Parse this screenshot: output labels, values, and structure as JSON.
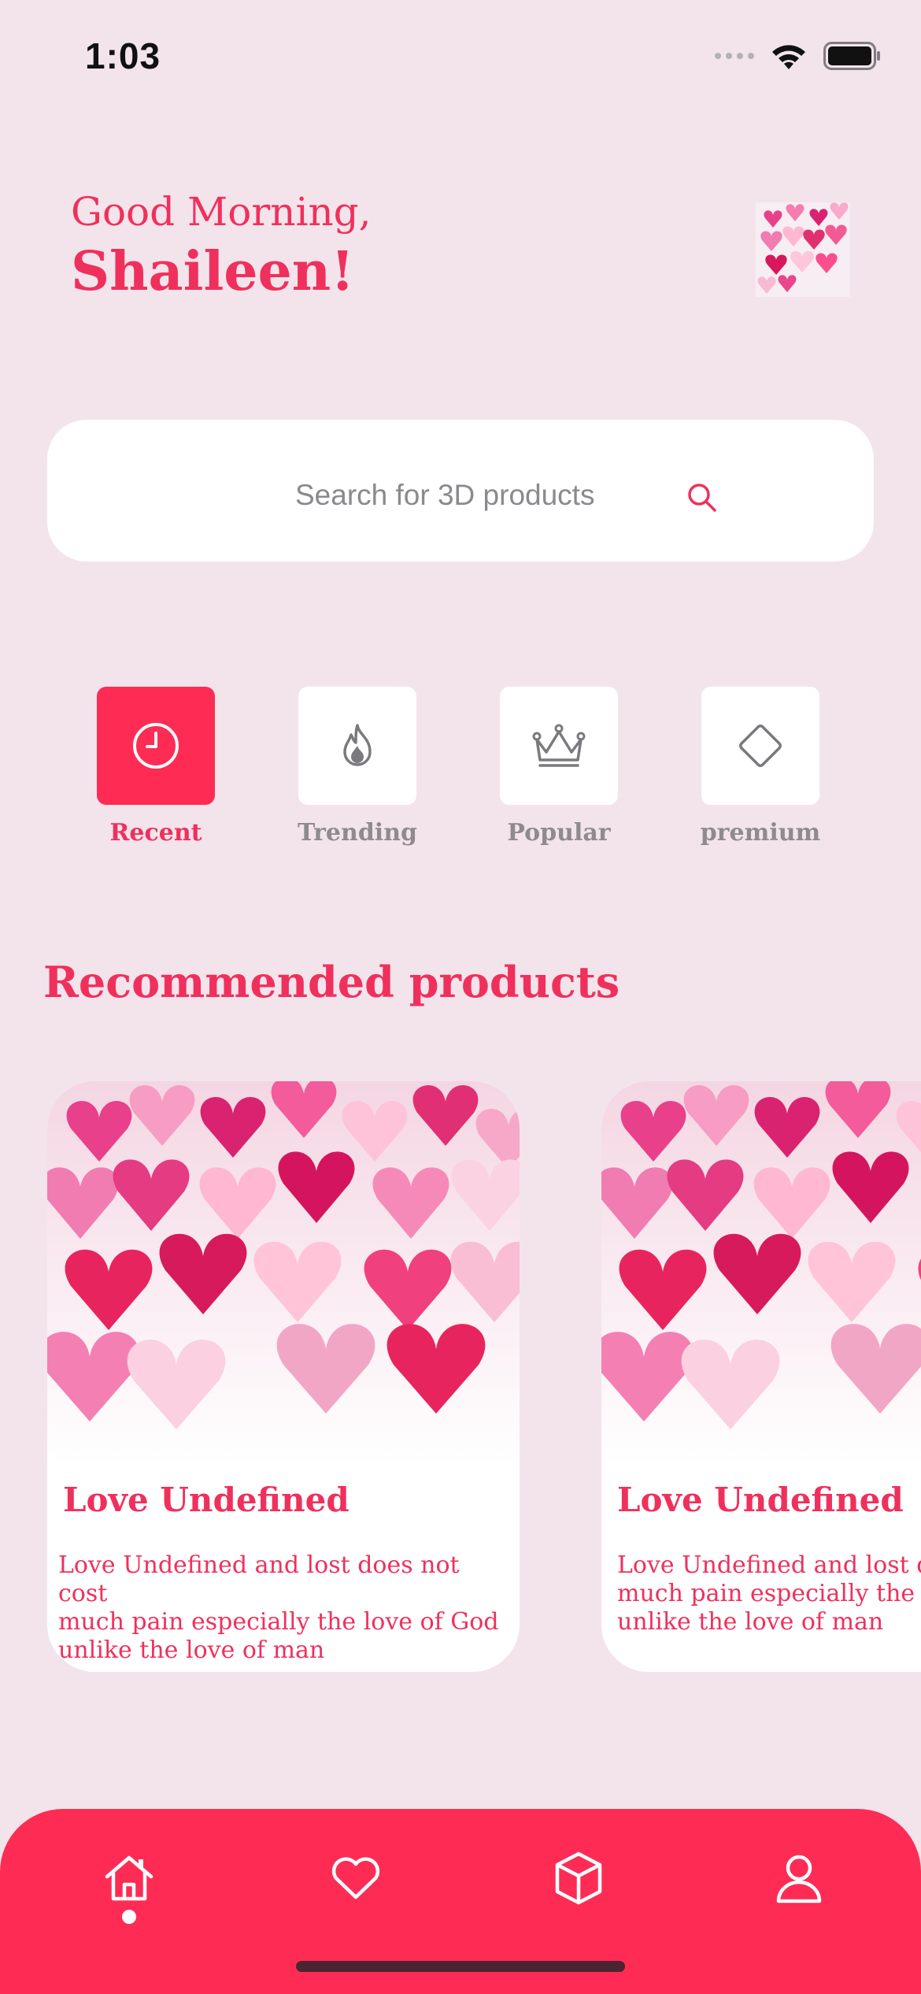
{
  "status_bar": {
    "time": "1:03",
    "icons": [
      "signal-icon",
      "wifi-icon",
      "battery-icon"
    ]
  },
  "greeting": {
    "line1": "Good Morning,",
    "line2": "Shaileen!"
  },
  "search": {
    "placeholder": "Search for 3D products",
    "icon": "search-icon"
  },
  "categories": [
    {
      "label": "Recent",
      "icon": "clock-icon",
      "active": true
    },
    {
      "label": "Trending",
      "icon": "flame-icon",
      "active": false
    },
    {
      "label": "Popular",
      "icon": "crown-icon",
      "active": false
    },
    {
      "label": "premium",
      "icon": "diamond-icon",
      "active": false
    }
  ],
  "section": {
    "title": "Recommended products"
  },
  "products": [
    {
      "title": "Love Undefined",
      "line1": "Love Undefined and lost does not cost",
      "line2": "much pain especially the love of God",
      "line3": "unlike the love of man"
    },
    {
      "title": "Love Undefined",
      "line1": "Love Undefined and lost does not cost",
      "line2": "much pain especially the love of God",
      "line3": "unlike the love of man"
    }
  ],
  "bottom_nav": {
    "items": [
      "home-icon",
      "heart-icon",
      "cube-icon",
      "user-icon"
    ],
    "active": "home-icon"
  },
  "colors": {
    "accent": "#fe2c55",
    "text_accent": "#f0305c",
    "background": "#f3e4ec",
    "muted": "#8f8a8c"
  }
}
